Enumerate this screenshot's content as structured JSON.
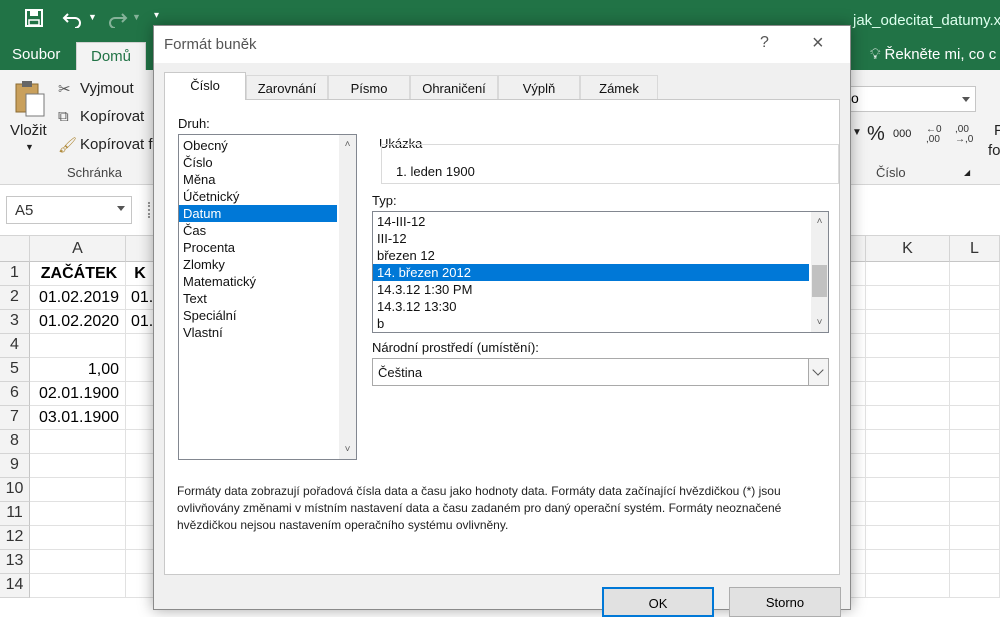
{
  "title_bar": {
    "file_name": "jak_odecitat_datumy.x"
  },
  "ribbon_tabs": [
    {
      "label": "Soubor"
    },
    {
      "label": "Domů"
    }
  ],
  "tell_me": "Řekněte mi, co c",
  "clipboard": {
    "paste_label": "Vložit",
    "cut_label": "Vyjmout",
    "copy_label": "Kopírovat",
    "format_painter_label": "Kopírovat f",
    "group_label": "Schránka"
  },
  "number_group": {
    "format_value": "o",
    "percent": "%",
    "thousands": "000",
    "group_label": "Číslo",
    "right_partial": "P",
    "right_partial2": "fo"
  },
  "name_box": "A5",
  "columns": [
    "A",
    "K",
    "L"
  ],
  "rows": [
    "1",
    "2",
    "3",
    "4",
    "5",
    "6",
    "7",
    "8",
    "9",
    "10",
    "11",
    "12",
    "13",
    "14"
  ],
  "cells_a": [
    "ZAČÁTEK",
    "01.02.2019",
    "01.02.2020",
    "",
    "1,00",
    "02.01.1900",
    "03.01.1900",
    "",
    "",
    "",
    "",
    "",
    "",
    ""
  ],
  "cells_b": [
    "K",
    "01.",
    "01.",
    "",
    "",
    "",
    "",
    "",
    "",
    "",
    "",
    "",
    "",
    ""
  ],
  "dialog": {
    "title": "Formát buněk",
    "help": "?",
    "close": "×",
    "tabs": [
      "Číslo",
      "Zarovnání",
      "Písmo",
      "Ohraničení",
      "Výplň",
      "Zámek"
    ],
    "category_label": "Druh:",
    "categories": [
      "Obecný",
      "Číslo",
      "Měna",
      "Účetnický",
      "Datum",
      "Čas",
      "Procenta",
      "Zlomky",
      "Matematický",
      "Text",
      "Speciální",
      "Vlastní"
    ],
    "selected_category": 4,
    "sample_label": "Ukázka",
    "sample_value": "1. leden 1900",
    "type_label": "Typ:",
    "types": [
      "14-III-12",
      "III-12",
      "březen 12",
      "14. březen 2012",
      "14.3.12 1:30 PM",
      "14.3.12 13:30",
      "b"
    ],
    "selected_type": 3,
    "locale_label": "Národní prostředí (umístění):",
    "locale_value": "Čeština",
    "description": "Formáty data zobrazují pořadová čísla data a času jako hodnoty data. Formáty data začínající hvězdičkou (*) jsou ovlivňovány změnami v místním nastavení data a času zadaném pro daný operační systém. Formáty neoznačené hvězdičkou nejsou nastavením operačního systému ovlivněny.",
    "ok_label": "OK",
    "cancel_label": "Storno"
  },
  "colors": {
    "accent": "#217346",
    "selection": "#0078d7"
  }
}
